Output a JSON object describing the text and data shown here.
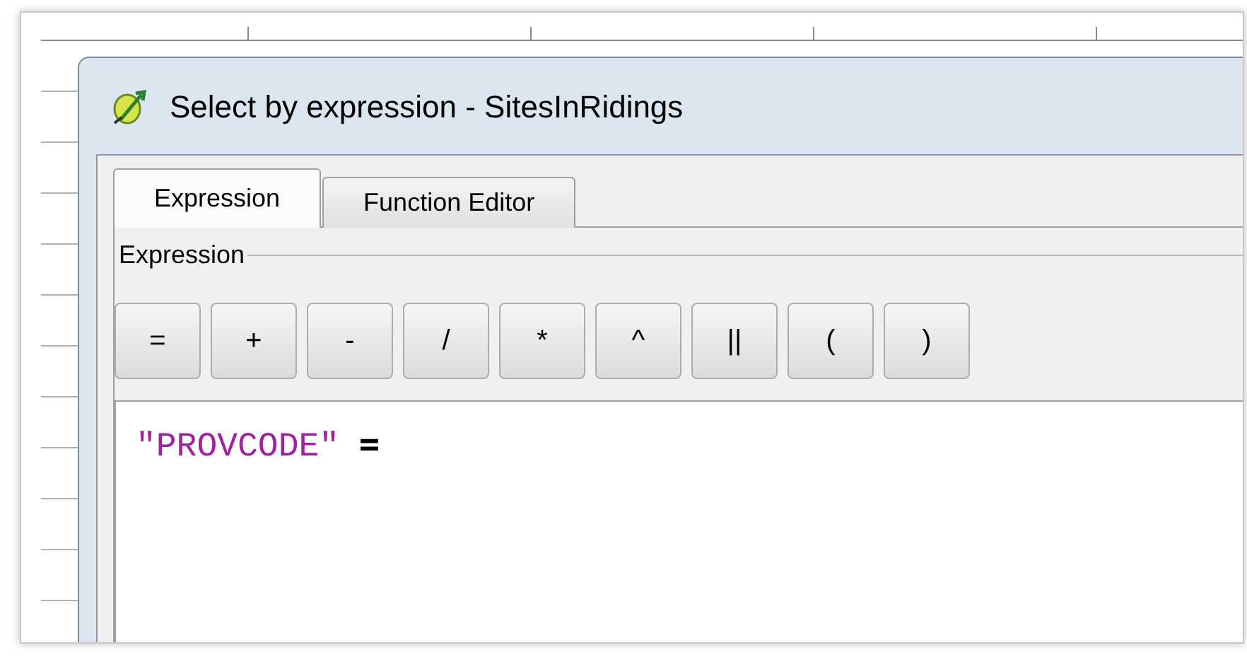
{
  "window": {
    "title": "Select by expression - SitesInRidings"
  },
  "tabs": [
    {
      "label": "Expression",
      "selected": true
    },
    {
      "label": "Function Editor",
      "selected": false
    }
  ],
  "group": {
    "label": "Expression"
  },
  "operator_buttons": [
    "=",
    "+",
    "-",
    "/",
    "*",
    "^",
    "||",
    "(",
    ")"
  ],
  "editor": {
    "tokens": [
      {
        "kind": "string",
        "text": "\"PROVCODE\""
      },
      {
        "kind": "operator",
        "text": "="
      }
    ]
  }
}
